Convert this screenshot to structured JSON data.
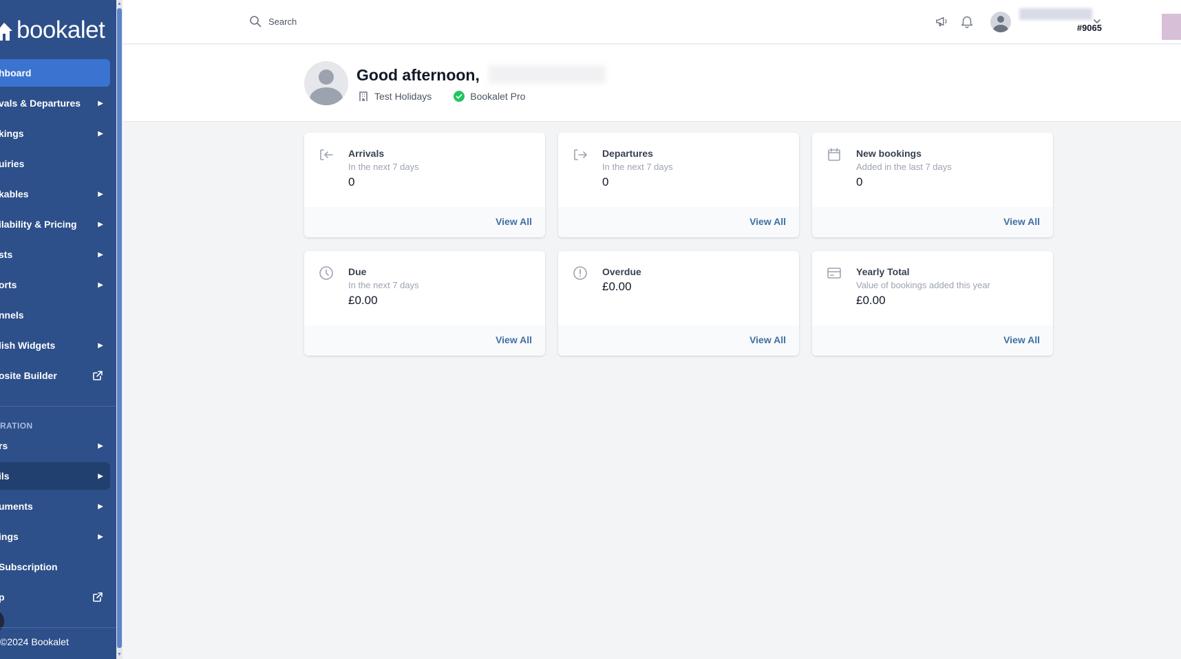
{
  "brand": {
    "name": "bookalet"
  },
  "search": {
    "placeholder": "Search"
  },
  "user": {
    "id": "#9065"
  },
  "sidebar": {
    "items": [
      {
        "label": "hboard",
        "arrow": false,
        "external": false
      },
      {
        "label": "vals & Departures",
        "arrow": true,
        "external": false
      },
      {
        "label": "kings",
        "arrow": true,
        "external": false
      },
      {
        "label": "uiries",
        "arrow": false,
        "external": false
      },
      {
        "label": "kables",
        "arrow": true,
        "external": false
      },
      {
        "label": "ilability & Pricing",
        "arrow": true,
        "external": false
      },
      {
        "label": "sts",
        "arrow": true,
        "external": false
      },
      {
        "label": "orts",
        "arrow": true,
        "external": false
      },
      {
        "label": "nnels",
        "arrow": false,
        "external": false
      },
      {
        "label": "lish Widgets",
        "arrow": true,
        "external": false
      },
      {
        "label": "osite Builder",
        "arrow": false,
        "external": true
      }
    ],
    "section_label": "RATION",
    "items2": [
      {
        "label": "rs",
        "arrow": true,
        "external": false
      },
      {
        "label": "ils",
        "arrow": true,
        "external": false
      },
      {
        "label": "uments",
        "arrow": true,
        "external": false
      },
      {
        "label": "ings",
        "arrow": true,
        "external": false
      },
      {
        "label": "Subscription",
        "arrow": false,
        "external": false
      },
      {
        "label": "p",
        "arrow": false,
        "external": true
      }
    ],
    "footer": "©2024 Bookalet"
  },
  "greeting": {
    "title": "Good afternoon,",
    "property": "Test Holidays",
    "plan": "Bookalet Pro"
  },
  "cards": [
    {
      "title": "Arrivals",
      "subtitle": "In the next 7 days",
      "value": "0",
      "link": "View All",
      "icon": "arrivals-icon"
    },
    {
      "title": "Departures",
      "subtitle": "In the next 7 days",
      "value": "0",
      "link": "View All",
      "icon": "departures-icon"
    },
    {
      "title": "New bookings",
      "subtitle": "Added in the last 7 days",
      "value": "0",
      "link": "View All",
      "icon": "calendar-icon"
    },
    {
      "title": "Due",
      "subtitle": "In the next 7 days",
      "value": "£0.00",
      "link": "View All",
      "icon": "clock-icon"
    },
    {
      "title": "Overdue",
      "subtitle": "",
      "value": "£0.00",
      "link": "View All",
      "icon": "alert-circle-icon"
    },
    {
      "title": "Yearly Total",
      "subtitle": "Value of bookings added this year",
      "value": "£0.00",
      "link": "View All",
      "icon": "credit-card-icon"
    }
  ],
  "colors": {
    "sidebar": "#2d4f8a",
    "active": "#3b73d0",
    "link": "#3f6fa6",
    "success": "#22c55e"
  }
}
